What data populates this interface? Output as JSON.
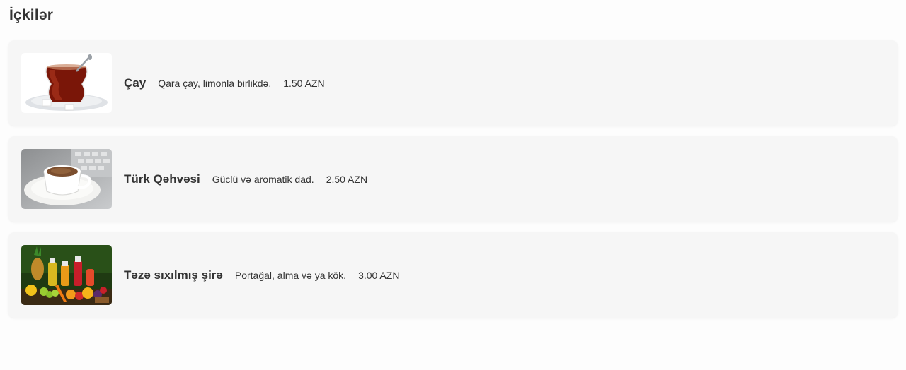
{
  "section": {
    "title": "İçkilər"
  },
  "items": [
    {
      "name": "Çay",
      "description": "Qara çay, limonla birlikdə.",
      "price": "1.50 AZN",
      "image": "tea-glass-image"
    },
    {
      "name": "Türk Qəhvəsi",
      "description": "Güclü və aromatik dad.",
      "price": "2.50 AZN",
      "image": "turkish-coffee-image"
    },
    {
      "name": "Təzə sıxılmış şirə",
      "description": "Portağal, alma və ya kök.",
      "price": "3.00 AZN",
      "image": "fresh-juice-image"
    }
  ],
  "colors": {
    "page_background": "#fdfdfd",
    "card_background": "#f6f6f6",
    "text": "#333333"
  }
}
